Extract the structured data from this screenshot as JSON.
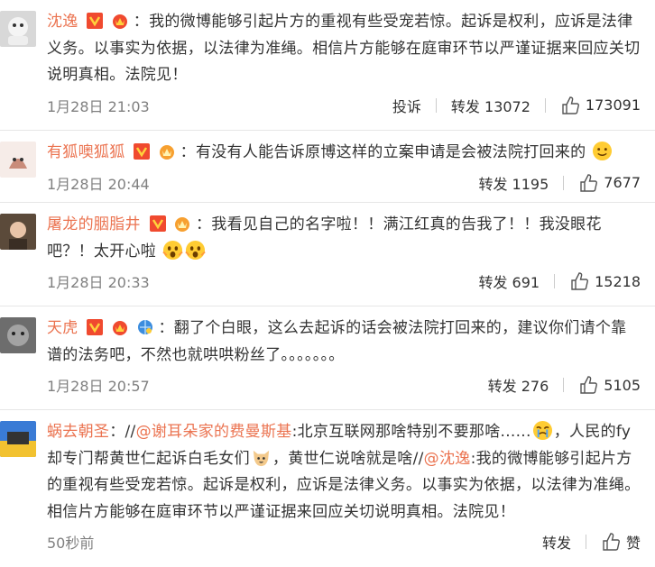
{
  "comments": [
    {
      "user": "沈逸",
      "text": "：我的微博能够引起片方的重视有些受宠若惊。起诉是权利，应诉是法律义务。以事实为依据，以法律为准绳。相信片方能够在庭审环节以严谨证据来回应关切说明真相。法院见！",
      "time": "1月28日 21:03",
      "report": "投诉",
      "forward": "转发 13072",
      "likes": "173091"
    },
    {
      "user": "有狐噢狐狐",
      "text": "：有没有人能告诉原博这样的立案申请是会被法院打回来的",
      "time": "1月28日 20:44",
      "forward": "转发 1195",
      "likes": "7677"
    },
    {
      "user": "屠龙的胭脂井",
      "text": "：我看见自己的名字啦！！满江红真的告我了！！我没眼花吧？！太开心啦",
      "time": "1月28日 20:33",
      "forward": "转发 691",
      "likes": "15218"
    },
    {
      "user": "天虎",
      "text": "：翻了个白眼，这么去起诉的话会被法院打回来的，建议你们请个靠谱的法务吧，不然也就哄哄粉丝了。。。。。。。",
      "time": "1月28日 20:57",
      "forward": "转发 276",
      "likes": "5105"
    },
    {
      "user": "蜗去朝圣",
      "text_a": "：//",
      "mention_a": "@谢耳朵家的费曼斯基",
      "text_b": ":北京互联网那啥特别不要那啥......",
      "text_c": "，人民的fy却专门帮黄世仁起诉白毛女们",
      "text_d": "，黄世仁说啥就是啥//",
      "mention_b": "@沈逸",
      "text_e": ":我的微博能够引起片方的重视有些受宠若惊。起诉是权利，应诉是法律义务。以事实为依据，以法律为准绳。相信片方能够在庭审环节以严谨证据来回应关切说明真相。法院见！",
      "time": "50秒前",
      "forward": "转发",
      "likes": "赞"
    }
  ],
  "colors": {
    "username": "#eb7350",
    "meta": "#808080",
    "text": "#333333"
  },
  "icons": [
    "v-badge-icon",
    "crown-level-icon",
    "globe-badge-icon",
    "thumbs-up-icon",
    "emoji-icon"
  ]
}
